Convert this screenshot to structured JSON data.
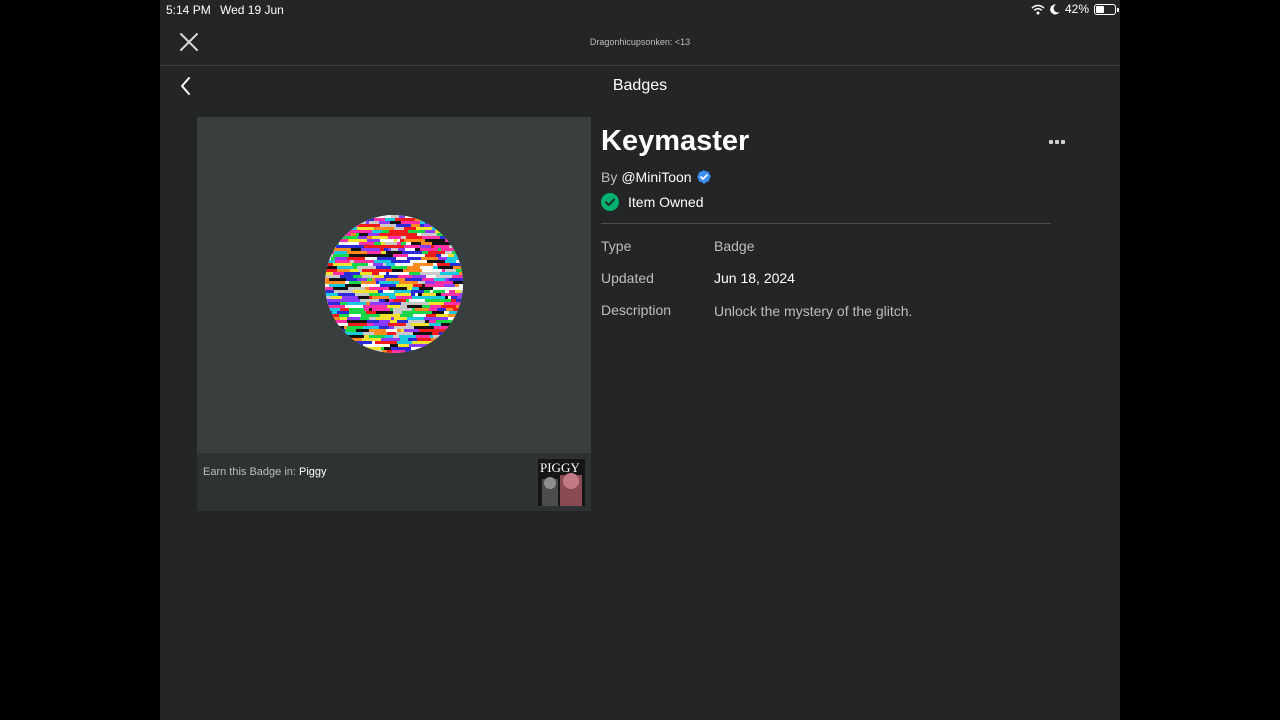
{
  "status_bar": {
    "time": "5:14 PM",
    "date": "Wed 19 Jun",
    "battery_percent": "42%",
    "battery_level": 0.42
  },
  "header": {
    "username": "Dragonhicupsonken: <13",
    "title": "Badges"
  },
  "badge": {
    "name": "Keymaster",
    "by_label": "By",
    "creator": "@MiniToon",
    "owned_label": "Item Owned",
    "earn_label": "Earn this Badge in:",
    "game_name": "Piggy",
    "game_thumb_text": "PIGGY"
  },
  "details": [
    {
      "label": "Type",
      "value": "Badge"
    },
    {
      "label": "Updated",
      "value": "Jun 18, 2024"
    },
    {
      "label": "Description",
      "value": "Unlock the mystery of the glitch."
    }
  ],
  "colors": {
    "background": "#232527",
    "thumb_bg": "#393d3e",
    "owned_green": "#00b06f",
    "verified_blue": "#3c8df0"
  },
  "icons": [
    "close-icon",
    "back-chevron-icon",
    "more-options-icon",
    "verified-icon",
    "checkmark-circle-icon",
    "wifi-icon",
    "moon-icon",
    "battery-icon"
  ]
}
